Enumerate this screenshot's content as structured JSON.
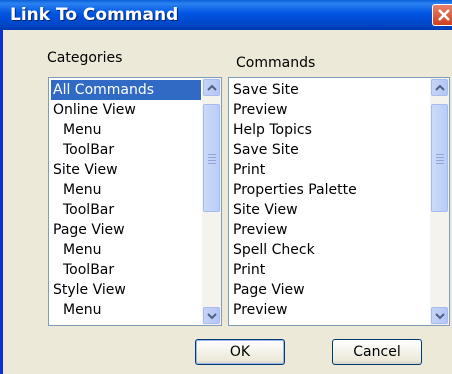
{
  "window": {
    "title": "Link To Command"
  },
  "categories": {
    "label": "Categories",
    "items": [
      {
        "text": "All Commands",
        "indent": false,
        "selected": true
      },
      {
        "text": "Online View",
        "indent": false
      },
      {
        "text": "Menu",
        "indent": true
      },
      {
        "text": "ToolBar",
        "indent": true
      },
      {
        "text": "Site View",
        "indent": false
      },
      {
        "text": "Menu",
        "indent": true
      },
      {
        "text": "ToolBar",
        "indent": true
      },
      {
        "text": "Page View",
        "indent": false
      },
      {
        "text": "Menu",
        "indent": true
      },
      {
        "text": "ToolBar",
        "indent": true
      },
      {
        "text": "Style View",
        "indent": false
      },
      {
        "text": "Menu",
        "indent": true
      }
    ]
  },
  "commands": {
    "label": "Commands",
    "items": [
      {
        "text": "Save Site"
      },
      {
        "text": "Preview"
      },
      {
        "text": "Help Topics"
      },
      {
        "text": "Save Site"
      },
      {
        "text": "Print"
      },
      {
        "text": "Properties Palette"
      },
      {
        "text": "Site View"
      },
      {
        "text": "Preview"
      },
      {
        "text": "Spell Check"
      },
      {
        "text": "Print"
      },
      {
        "text": "Page View"
      },
      {
        "text": "Preview"
      }
    ]
  },
  "buttons": {
    "ok": "OK",
    "cancel": "Cancel"
  },
  "colors": {
    "titlebar": "#0054e3",
    "selection": "#316ac5",
    "dialog": "#ece9d8"
  }
}
